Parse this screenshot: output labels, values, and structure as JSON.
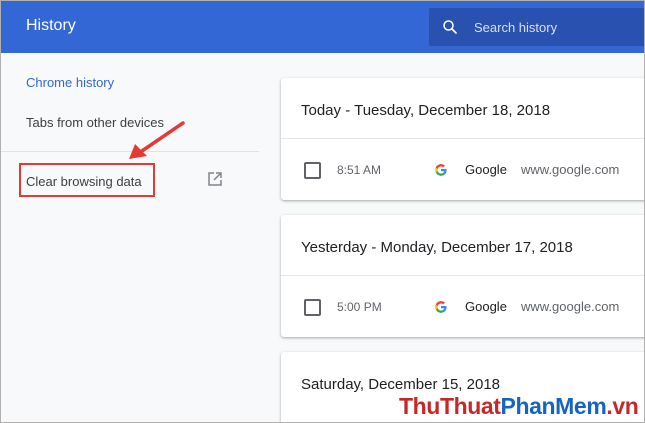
{
  "header": {
    "title": "History",
    "search_placeholder": "Search history",
    "search_value": ""
  },
  "sidebar": {
    "items": [
      {
        "label": "Chrome history",
        "active": true
      },
      {
        "label": "Tabs from other devices",
        "active": false
      }
    ],
    "clear_browsing_data": "Clear browsing data",
    "external_icon": "open-in-new-icon"
  },
  "history": {
    "days": [
      {
        "heading": "Today - Tuesday, December 18, 2018",
        "entries": [
          {
            "time": "8:51 AM",
            "title": "Google",
            "domain": "www.google.com",
            "icon": "google-favicon"
          }
        ]
      },
      {
        "heading": "Yesterday - Monday, December 17, 2018",
        "entries": [
          {
            "time": "5:00 PM",
            "title": "Google",
            "domain": "www.google.com",
            "icon": "google-favicon"
          }
        ]
      },
      {
        "heading": "Saturday, December 15, 2018",
        "entries": []
      }
    ]
  },
  "annotation": {
    "highlight_color": "#e53935"
  },
  "watermark": {
    "part1": "ThuThuat",
    "part2": "PhanMem",
    "part3": ".vn"
  },
  "colors": {
    "accent": "#3367d6",
    "search_bg": "#2951b0",
    "page_bg": "#f8f9fa"
  }
}
